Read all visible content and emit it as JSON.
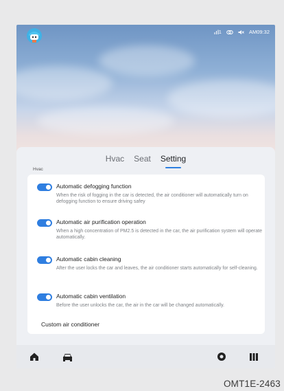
{
  "status_bar": {
    "signal_text": "1",
    "time": "AM09:32",
    "icons": [
      "signal-icon",
      "link-icon",
      "volume-mute-icon"
    ]
  },
  "tabs": [
    {
      "label": "Hvac",
      "active": false
    },
    {
      "label": "Seat",
      "active": false
    },
    {
      "label": "Setting",
      "active": true
    }
  ],
  "section_label": "Hvac",
  "settings": [
    {
      "title": "Automatic defogging function",
      "description": "When the risk of fogging in the car is detected, the air conditioner will automatically turn on defogging function to ensure driving safey",
      "enabled": true
    },
    {
      "title": "Automatic air purification operation",
      "description": "When a high concentration of PM2.5 is detected in the car, the air purification system will operate automatically.",
      "enabled": true
    },
    {
      "title": "Automatic cabin cleaning",
      "description": "After the user locks the car and leaves, the air conditioner starts automatically for self-cleaning.",
      "enabled": true
    },
    {
      "title": "Automatic cabin ventilation",
      "description": "Before the user unlocks the car, the air in the car will be changed automatically.",
      "enabled": true
    }
  ],
  "custom_label": "Custom air conditioner",
  "bottom_nav": [
    "home-icon",
    "car-icon",
    "record-icon",
    "media-icon"
  ],
  "figure_code": "OMT1E-2463",
  "colors": {
    "accent": "#2f7ee0",
    "panel": "#eef0f4"
  }
}
